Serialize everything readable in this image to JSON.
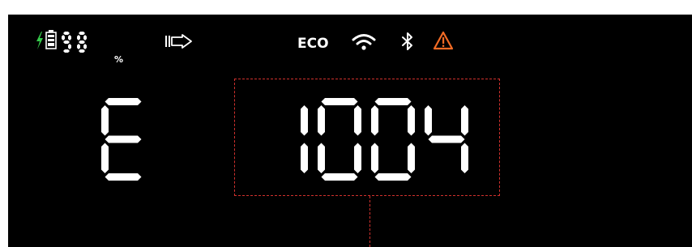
{
  "status_bar": {
    "charging_icon": "lightning-bolt-icon",
    "battery_icon": "battery-icon",
    "battery_level": "98",
    "battery_unit": "%",
    "output_icon": "ac-output-arrow-icon",
    "mode_label": "ECO",
    "wifi_icon": "wifi-icon",
    "bluetooth_icon": "bluetooth-icon",
    "warning_icon": "warning-triangle-icon"
  },
  "display": {
    "error_prefix": "E",
    "error_code": "1004"
  },
  "colors": {
    "charging": "#35c94a",
    "warning": "#f26b25",
    "segment": "#ffffff",
    "background": "#000000",
    "highlight": "#d0312d"
  }
}
